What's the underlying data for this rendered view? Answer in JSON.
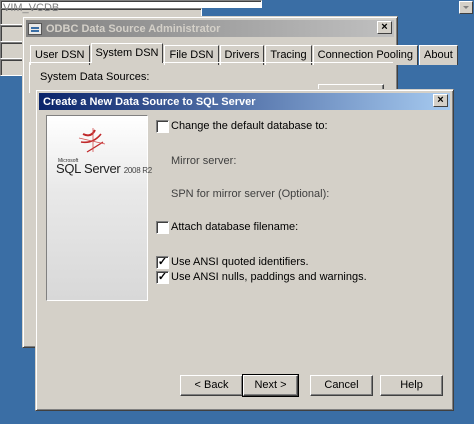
{
  "back_window": {
    "title": "ODBC Data Source Administrator",
    "close": "×",
    "tabs": [
      "User DSN",
      "System DSN",
      "File DSN",
      "Drivers",
      "Tracing",
      "Connection Pooling",
      "About"
    ],
    "selected_tab": 1,
    "system_sources_label": "System Data Sources:"
  },
  "dialog": {
    "title": "Create a New Data Source to SQL Server",
    "close": "×",
    "logo": {
      "maker": "Microsoft",
      "product": "SQL Server",
      "version": "2008 R2"
    },
    "change_default_db": {
      "label": "Change the default database to:",
      "checked": false
    },
    "database_select": {
      "value": "VIM_VCDB"
    },
    "mirror_server": {
      "label": "Mirror server:",
      "value": ""
    },
    "spn": {
      "label": "SPN for mirror server (Optional):",
      "value": ""
    },
    "attach_db": {
      "label": "Attach database filename:",
      "checked": false,
      "value": ""
    },
    "ansi_quoted": {
      "label": "Use ANSI quoted identifiers.",
      "checked": true
    },
    "ansi_nulls": {
      "label": "Use ANSI nulls, paddings and warnings.",
      "checked": true
    },
    "buttons": {
      "back": "< Back",
      "next": "Next >",
      "cancel": "Cancel",
      "help": "Help"
    }
  },
  "icons": {
    "check": "✓"
  },
  "colors": {
    "desktop": "#3a6ea5",
    "active_title": "#0a246a",
    "inactive_title": "#808080",
    "face": "#d4d0c8"
  }
}
